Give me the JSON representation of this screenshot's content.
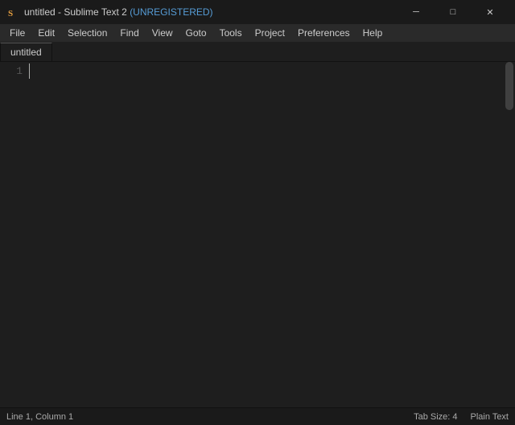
{
  "titleBar": {
    "title": "untitled - Sublime Text 2 ",
    "unregistered": "(UNREGISTERED)",
    "appIconColor": "#cc6600"
  },
  "windowControls": {
    "minimizeLabel": "─",
    "maximizeLabel": "□",
    "closeLabel": "✕"
  },
  "menuBar": {
    "items": [
      {
        "label": "File"
      },
      {
        "label": "Edit"
      },
      {
        "label": "Selection"
      },
      {
        "label": "Find"
      },
      {
        "label": "View"
      },
      {
        "label": "Goto"
      },
      {
        "label": "Tools"
      },
      {
        "label": "Project"
      },
      {
        "label": "Preferences"
      },
      {
        "label": "Help"
      }
    ]
  },
  "tabs": {
    "activeTab": "untitled"
  },
  "editor": {
    "lineNumbers": [
      "1"
    ]
  },
  "statusBar": {
    "position": "Line 1, Column 1",
    "tabSize": "Tab Size: 4",
    "syntax": "Plain Text"
  }
}
